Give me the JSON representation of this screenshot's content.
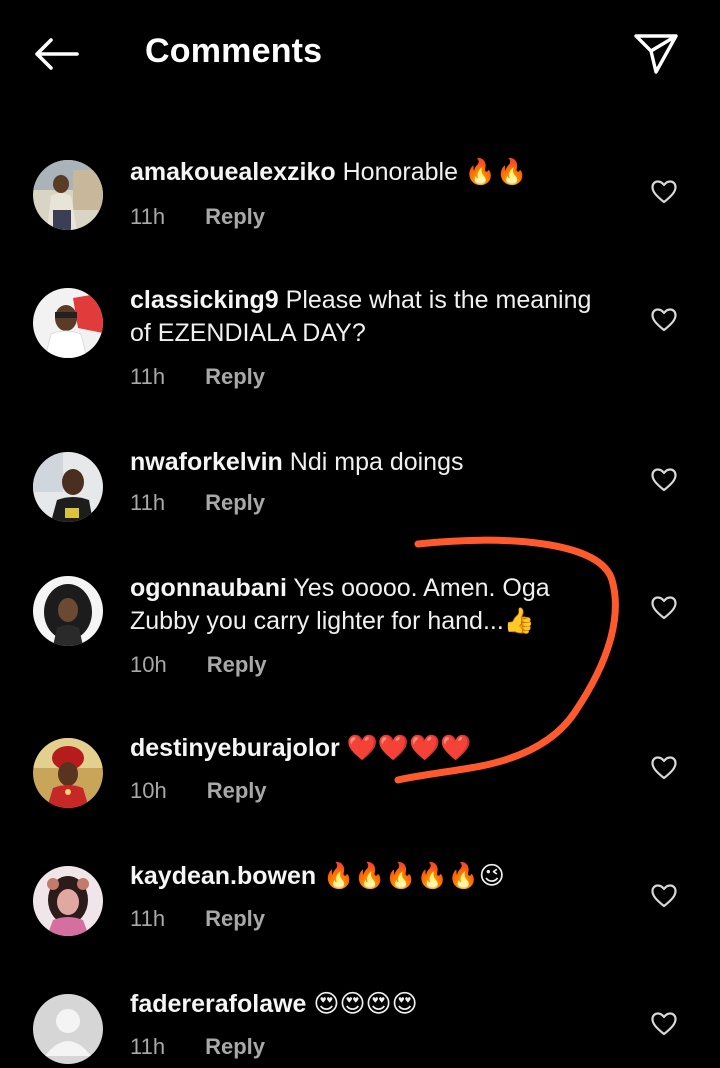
{
  "header": {
    "title": "Comments",
    "back_icon": "arrow-left-icon",
    "share_icon": "paper-plane-icon"
  },
  "comments": [
    {
      "username": "amakouealexziko",
      "text": "Honorable 🔥🔥",
      "time": "11h",
      "reply": "Reply"
    },
    {
      "username": "classicking9",
      "text": "Please what is the meaning of EZENDIALA DAY?",
      "time": "11h",
      "reply": "Reply"
    },
    {
      "username": "nwaforkelvin",
      "text": "Ndi mpa doings",
      "time": "11h",
      "reply": "Reply"
    },
    {
      "username": "ogonnaubani",
      "text": "Yes ooooo. Amen. Oga Zubby you carry lighter for hand...👍",
      "time": "10h",
      "reply": "Reply"
    },
    {
      "username": "destinyeburajolor",
      "text": "❤️❤️❤️❤️",
      "time": "10h",
      "reply": "Reply"
    },
    {
      "username": "kaydean.bowen",
      "text": "🔥🔥🔥🔥🔥😉",
      "time": "11h",
      "reply": "Reply"
    },
    {
      "username": "fadererafolawe",
      "text": "😍😍😍😍",
      "time": "11h",
      "reply": "Reply"
    }
  ],
  "colors": {
    "background": "#000000",
    "text": "#f5f5f5",
    "secondary": "#a8a8a8",
    "annotation": "#ff5a2e"
  }
}
